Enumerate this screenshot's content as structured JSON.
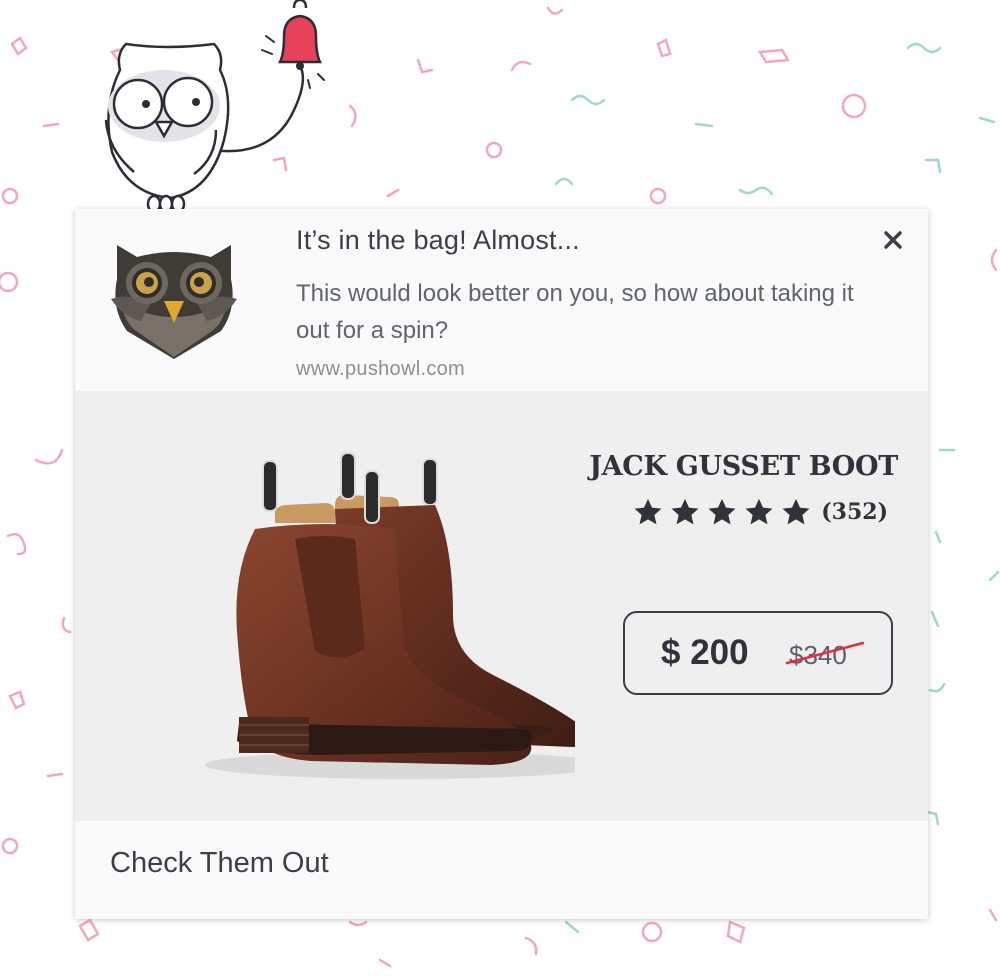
{
  "notification": {
    "title": "It’s in the bag! Almost...",
    "body": "This would look better on you, so how about taking it out for a spin?",
    "url": "www.pushowl.com",
    "close_icon": "close-icon",
    "app_icon": "owl-icon"
  },
  "product": {
    "name": "JACK GUSSET BOOT",
    "rating": 5,
    "review_count": "(352)",
    "price_current": "$ 200",
    "price_old": "$340",
    "image": "brown-chelsea-boots"
  },
  "action": {
    "label": "Check Them Out"
  },
  "colors": {
    "card_bg": "#fafafa",
    "product_bg": "#efefef",
    "text_dark": "#30333a",
    "strike_red": "#e0303f",
    "confetti_pink": "#f3a8b8",
    "confetti_mint": "#9fd9c9",
    "bell_red": "#e8415a"
  }
}
